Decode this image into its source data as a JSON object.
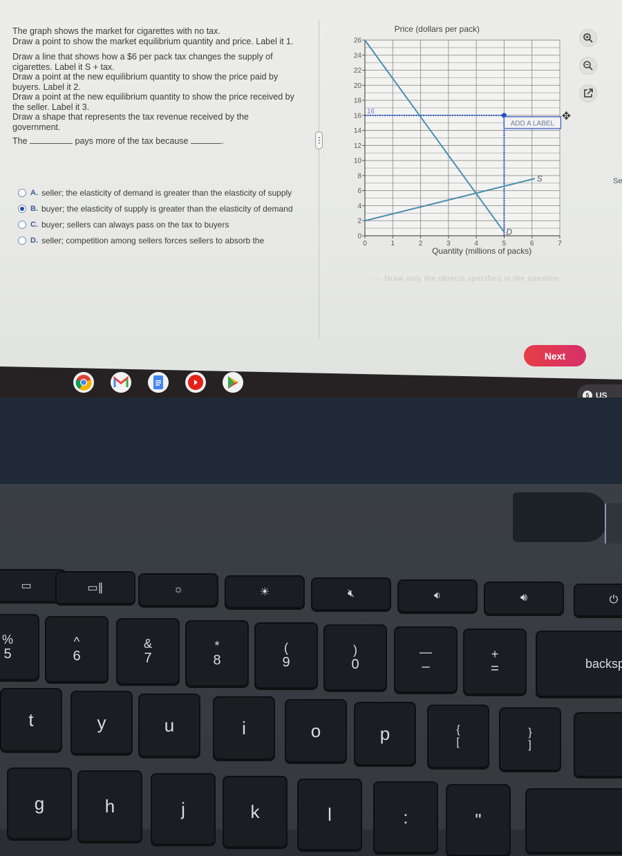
{
  "question": {
    "line1": "The graph shows the market for cigarettes with no tax.",
    "line2": "Draw a point to show the market equilibrium quantity and price. Label it 1.",
    "line3": "Draw a line that shows how a $6 per pack tax changes the supply of cigarettes. Label it S + tax.",
    "line4": "Draw a point at the new equilibrium quantity to show the price paid by buyers. Label it 2.",
    "line5": "Draw a point at the new equilibrium quantity to show the price received by the seller. Label it 3.",
    "line6": "Draw a shape that represents the tax revenue received by the government.",
    "fill_prefix": "The",
    "fill_middle": "pays more of the tax because",
    "fill_suffix": "."
  },
  "options": [
    {
      "letter": "A.",
      "text": "seller; the elasticity of demand is greater than the elasticity of supply",
      "selected": false
    },
    {
      "letter": "B.",
      "text": "buyer; the elasticity of supply is greater than the elasticity of demand",
      "selected": true
    },
    {
      "letter": "C.",
      "text": "buyer; sellers can always pass on the tax to buyers",
      "selected": false
    },
    {
      "letter": "D.",
      "text": "seller; competition among sellers forces sellers to absorb the",
      "selected": false
    }
  ],
  "chart_data": {
    "type": "line",
    "title": "",
    "ylabel": "Price (dollars per pack)",
    "xlabel": "Quantity (millions of packs)",
    "xlim": [
      0,
      7
    ],
    "ylim": [
      0,
      26
    ],
    "xticks": [
      "0",
      "1",
      "2",
      "3",
      "4",
      "5",
      "6",
      "7"
    ],
    "yticks": [
      "0",
      "2",
      "4",
      "6",
      "8",
      "10",
      "12",
      "14",
      "16",
      "18",
      "20",
      "22",
      "24",
      "26"
    ],
    "grid": true,
    "series": [
      {
        "name": "D",
        "color": "#4a8fb0",
        "points": [
          [
            0,
            26
          ],
          [
            5,
            0.5
          ]
        ]
      },
      {
        "name": "S",
        "color": "#4a8fb0",
        "points": [
          [
            0,
            2
          ],
          [
            6.1,
            7.6
          ]
        ]
      }
    ],
    "placed_point": {
      "x": 5,
      "y": 16,
      "color": "#1f4fc4",
      "y_label": "16",
      "label_box": "ADD A LABEL"
    }
  },
  "tools": {
    "zoom_in": "zoom-in",
    "zoom_out": "zoom-out",
    "popout": "open-in-new-window"
  },
  "cut_text": "--- Draw only the objects specified in the question",
  "side_text": "Se",
  "next_label": "Next",
  "shelf": {
    "apps": [
      "Chrome",
      "Gmail",
      "Docs",
      "YouTube",
      "Play Store"
    ],
    "tray_count": "5",
    "tray_locale": "US"
  },
  "keyboard": {
    "fn_row": [
      "window-icon",
      "overview-icon",
      "brightness-down-icon",
      "brightness-up-icon",
      "mute-icon",
      "volume-down-icon",
      "volume-up-icon",
      "power-icon"
    ],
    "num_row": [
      {
        "top": "%",
        "bot": "5"
      },
      {
        "top": "^",
        "bot": "6"
      },
      {
        "top": "&",
        "bot": "7"
      },
      {
        "top": "*",
        "bot": "8"
      },
      {
        "top": "(",
        "bot": "9"
      },
      {
        "top": ")",
        "bot": "0"
      },
      {
        "top": "—",
        "bot": "–"
      },
      {
        "top": "+",
        "bot": "="
      },
      {
        "top": "",
        "bot": "backspace"
      }
    ],
    "top_row": [
      "t",
      "y",
      "u",
      "i",
      "o",
      "p",
      "{ [",
      "} ]"
    ],
    "home_row": [
      "g",
      "h",
      "j",
      "k",
      "l",
      ":",
      "\""
    ]
  }
}
